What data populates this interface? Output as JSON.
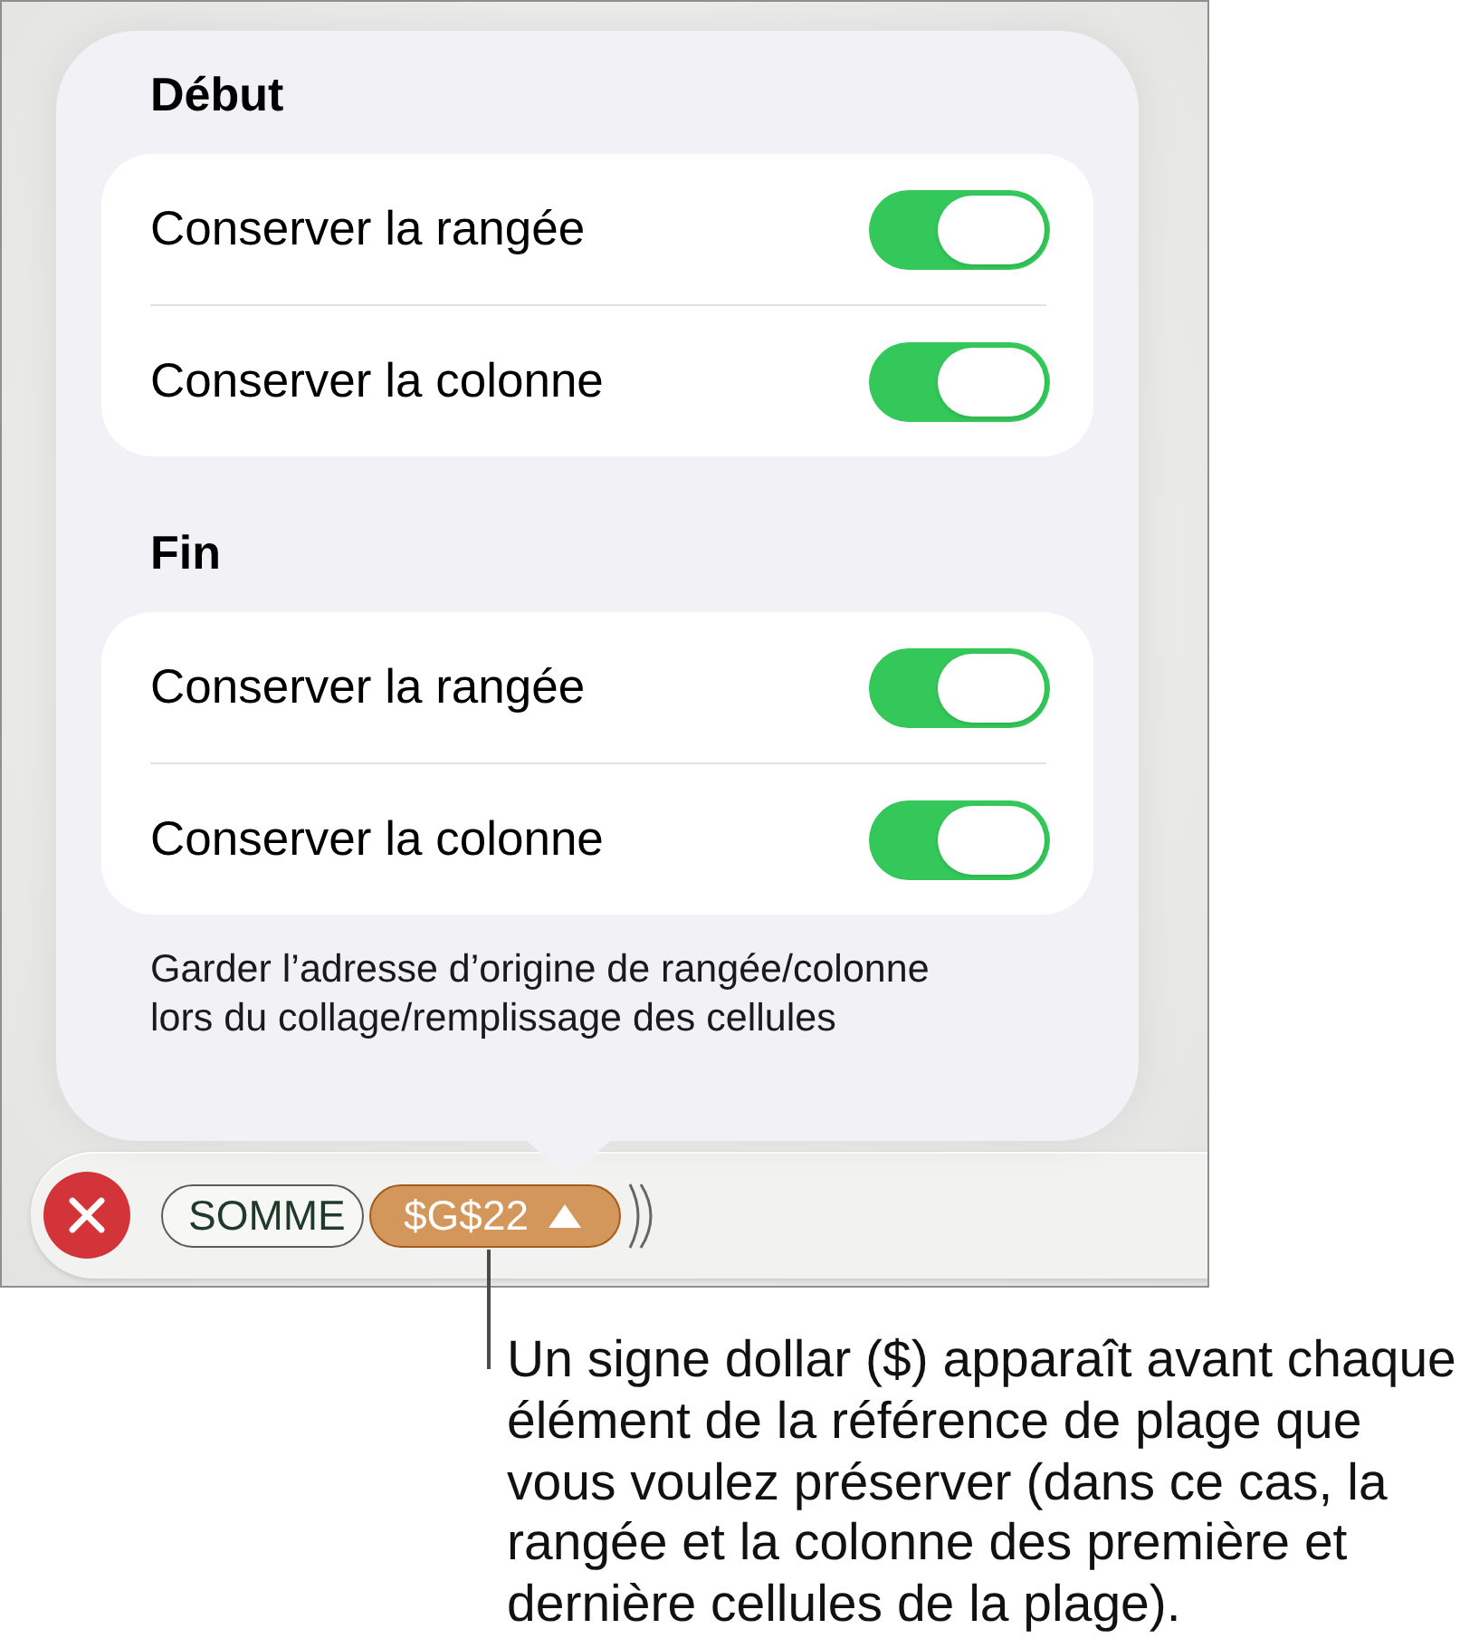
{
  "sections": [
    {
      "title": "Début",
      "rows": [
        {
          "label": "Conserver la rangée",
          "on": true
        },
        {
          "label": "Conserver la colonne",
          "on": true
        }
      ]
    },
    {
      "title": "Fin",
      "rows": [
        {
          "label": "Conserver la rangée",
          "on": true
        },
        {
          "label": "Conserver la colonne",
          "on": true
        }
      ]
    }
  ],
  "footnote": "Garder l’adresse d’origine de rangée/colonne\nlors du collage/remplissage des cellules",
  "formula_bar": {
    "tokens": [
      {
        "kind": "function",
        "text": "SOMME",
        "selected": false
      },
      {
        "kind": "reference",
        "text": "$G$22",
        "selected": true
      }
    ]
  },
  "callout": "Un signe dollar ($) apparaît avant chaque\nélément de la référence de plage que\nvous voulez préserver (dans ce cas, la\nrangée et la colonne des première et\ndernière cellules de la plage)."
}
